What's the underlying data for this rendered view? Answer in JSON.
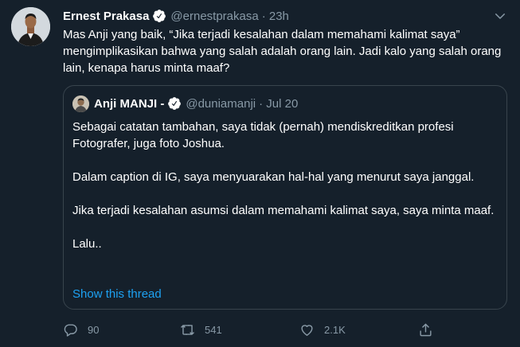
{
  "tweet": {
    "author_name": "Ernest Prakasa",
    "handle": "@ernestprakasa",
    "time": "· 23h",
    "text": "Mas Anji yang baik, “Jika terjadi kesalahan dalam memahami kalimat saya” mengimplikasikan bahwa yang salah adalah orang lain. Jadi kalo yang salah orang lain, kenapa harus minta maaf?"
  },
  "quoted": {
    "author_name": "Anji MANJI -",
    "handle": "@duniamanji",
    "time": "· Jul 20",
    "paragraphs": [
      "Sebagai catatan tambahan, saya tidak (pernah) mendiskreditkan profesi Fotografer, juga foto Joshua.",
      "Dalam caption di IG, saya menyuarakan hal-hal yang menurut saya janggal.",
      "Jika terjadi kesalahan asumsi dalam memahami kalimat saya, saya minta maaf.",
      "Lalu.."
    ],
    "show_thread": "Show this thread"
  },
  "actions": {
    "reply_count": "90",
    "retweet_count": "541",
    "like_count": "2.1K"
  },
  "colors": {
    "background": "#15202b",
    "border": "#38444d",
    "muted": "#8899a6",
    "link": "#1da1f2"
  },
  "icons": [
    "verified-badge-icon",
    "chevron-down-icon",
    "reply-icon",
    "retweet-icon",
    "like-icon",
    "share-icon"
  ]
}
